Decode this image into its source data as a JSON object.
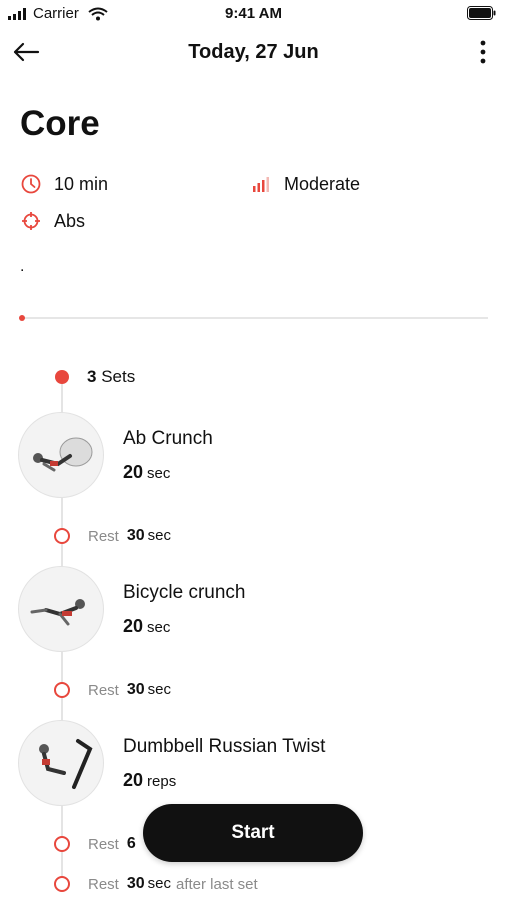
{
  "status_bar": {
    "carrier": "Carrier",
    "time": "9:41 AM"
  },
  "nav": {
    "title": "Today, 27 Jun",
    "back_icon": "arrow-left-icon",
    "more_icon": "more-vertical-icon"
  },
  "workout": {
    "title": "Core",
    "duration": "10 min",
    "difficulty": "Moderate",
    "target": "Abs",
    "description": "."
  },
  "sets": {
    "count": "3",
    "label": "Sets"
  },
  "exercises": [
    {
      "name": "Ab Crunch",
      "amount": "20",
      "unit": "sec"
    },
    {
      "name": "Bicycle crunch",
      "amount": "20",
      "unit": "sec"
    },
    {
      "name": "Dumbbell Russian Twist",
      "amount": "20",
      "unit": "reps"
    }
  ],
  "rests": [
    {
      "label": "Rest",
      "value": "30",
      "unit": "sec",
      "suffix": ""
    },
    {
      "label": "Rest",
      "value": "30",
      "unit": "sec",
      "suffix": ""
    },
    {
      "label": "Rest",
      "value": "6",
      "unit": "",
      "suffix": ""
    },
    {
      "label": "Rest",
      "value": "30",
      "unit": "sec",
      "suffix": "after last set"
    }
  ],
  "start_button": {
    "label": "Start"
  },
  "colors": {
    "accent": "#e8473d",
    "button": "#111111"
  }
}
